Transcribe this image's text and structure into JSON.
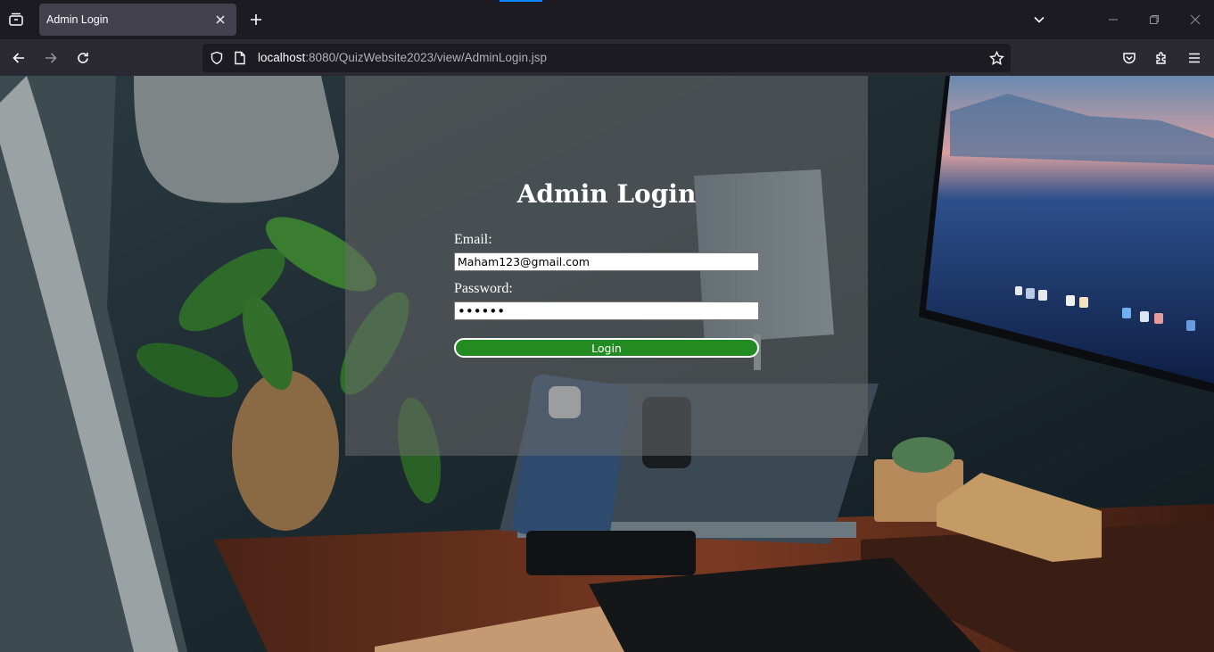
{
  "browser": {
    "tab_title": "Admin Login",
    "url_host": "localhost",
    "url_path": ":8080/QuizWebsite2023/view/AdminLogin.jsp",
    "accent": "#0a84ff"
  },
  "page": {
    "title": "Admin Login",
    "email_label": "Email:",
    "email_value": "Maham123@gmail.com",
    "password_label": "Password:",
    "password_value": "••••••",
    "login_label": "Login",
    "button_color": "#228b22"
  },
  "icons": [
    "tab-list-icon",
    "close-icon",
    "plus-icon",
    "chevron-down-icon",
    "minimize-icon",
    "restore-icon",
    "back-icon",
    "forward-icon",
    "reload-icon",
    "shield-icon",
    "page-icon",
    "star-icon",
    "pocket-icon",
    "extensions-icon",
    "menu-icon"
  ]
}
